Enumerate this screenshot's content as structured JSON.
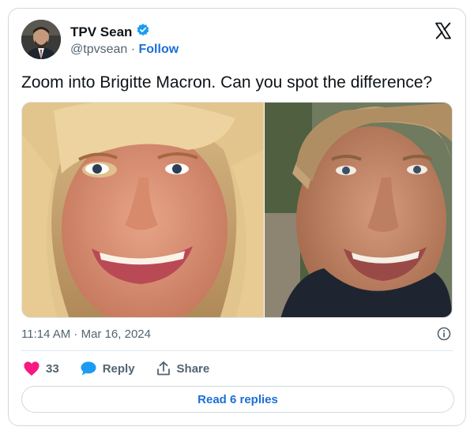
{
  "author": {
    "name": "TPV Sean",
    "handle": "@tpvsean",
    "separator": " · ",
    "follow_label": "Follow",
    "verified": true
  },
  "tweet": {
    "text": "Zoom into Brigitte Macron. Can you spot the difference?",
    "timestamp": "11:14 AM · Mar 16, 2024"
  },
  "engagement": {
    "likes": "33",
    "reply_label": "Reply",
    "share_label": "Share",
    "read_replies_label": "Read 6 replies"
  },
  "icons": {
    "platform": "x-logo-icon",
    "verified": "verified-badge-icon",
    "info": "info-icon",
    "like": "heart-icon",
    "reply": "speech-bubble-icon",
    "share": "share-upload-icon"
  },
  "colors": {
    "link": "#1d6fd6",
    "verified": "#1d9bf0",
    "like": "#f91880",
    "reply": "#1d9bf0",
    "text": "#0f1419",
    "muted": "#536471"
  }
}
